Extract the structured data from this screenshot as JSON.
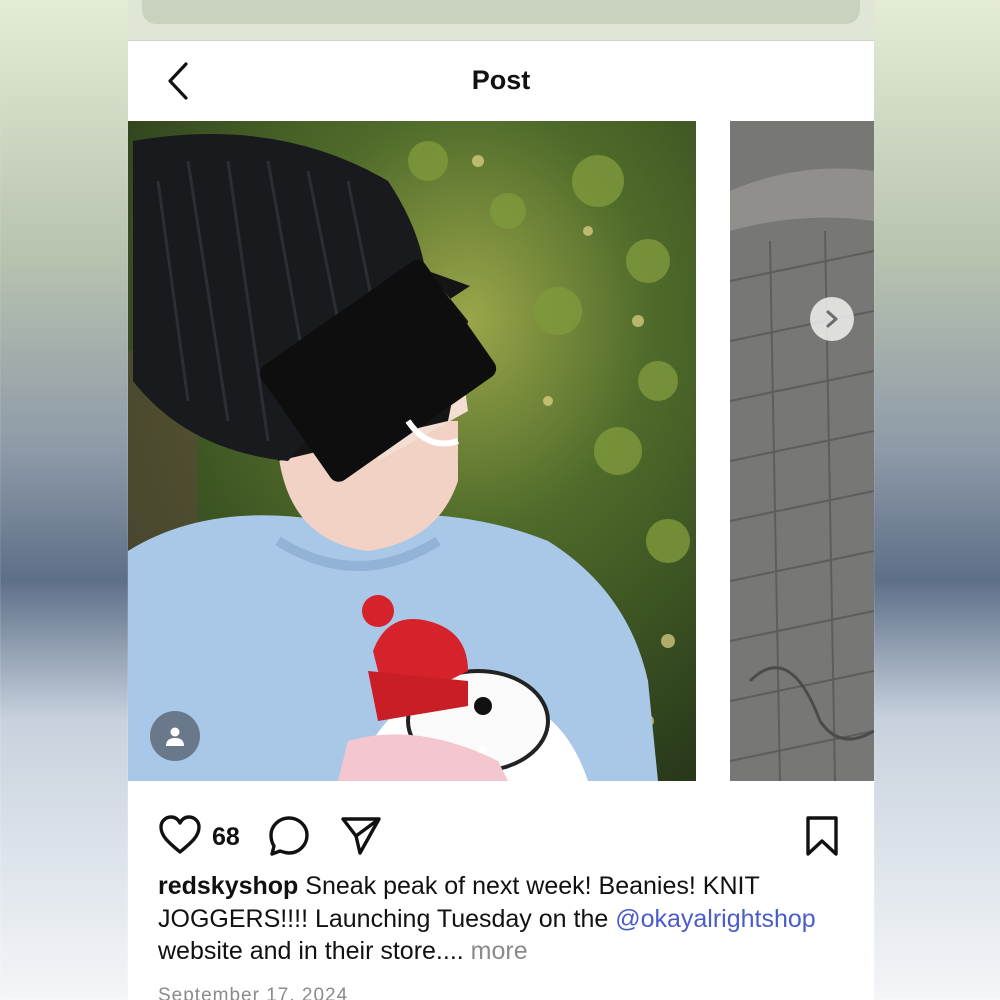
{
  "nav": {
    "title": "Post",
    "back_icon": "chevron-left-icon"
  },
  "media": {
    "next_icon": "chevron-right-icon",
    "tag_icon": "user-icon",
    "carousel_position": {
      "current": 1,
      "total": 2
    }
  },
  "actions": {
    "like_icon": "heart-icon",
    "like_count": "68",
    "comment_icon": "comment-icon",
    "share_icon": "send-icon",
    "save_icon": "bookmark-icon"
  },
  "caption": {
    "username": "redskyshop",
    "text_before": " Sneak peak of next week! Beanies! KNIT JOGGERS!!!! Launching Tuesday on the ",
    "mention": "@okayalrightshop",
    "text_after": " website and in their store.... ",
    "more": "more"
  },
  "date": "September 17, 2024",
  "colors": {
    "mention": "#4a5cc9",
    "muted": "#8a8a8a",
    "text": "#111111"
  }
}
